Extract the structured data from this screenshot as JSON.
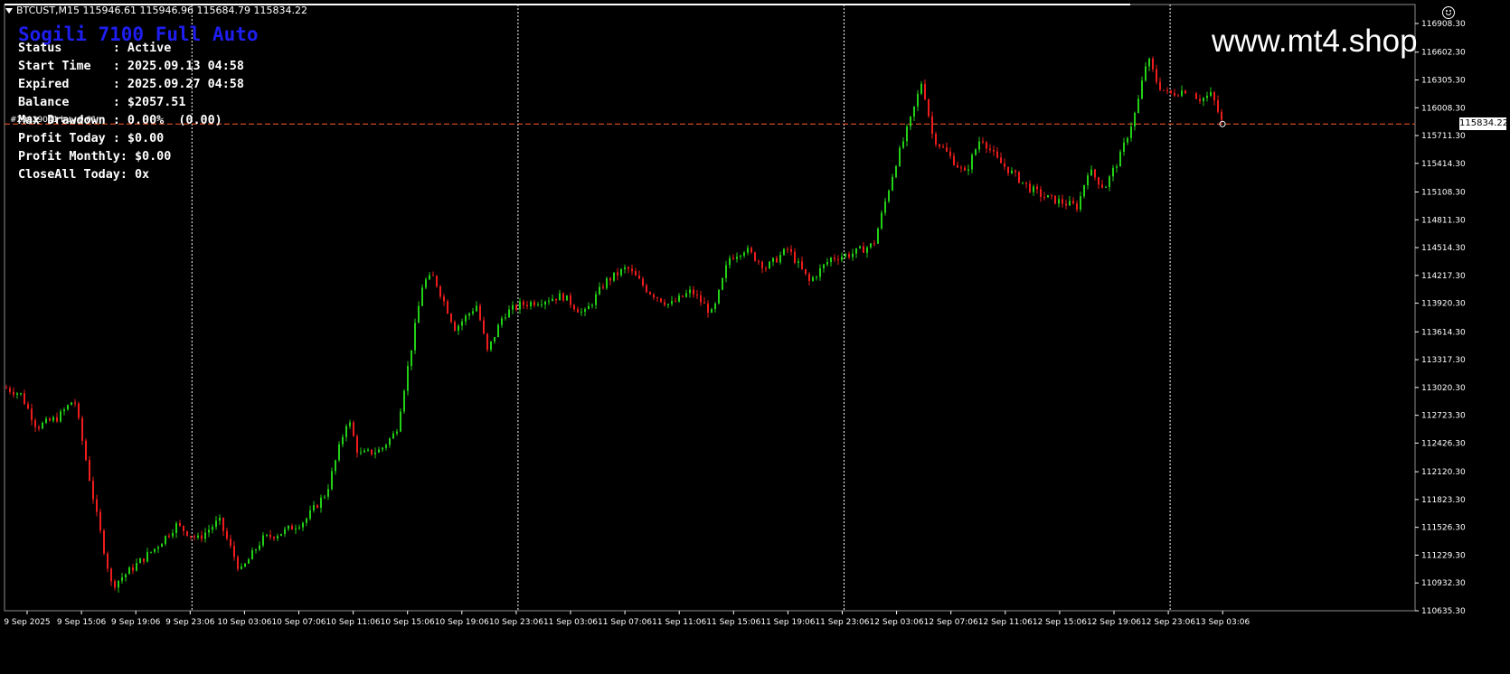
{
  "header": {
    "symbol": "BTCUST,M15",
    "ohlc": "115946.61 115946.96 115684.79 115834.22"
  },
  "ea": {
    "title": "Sogili 7100 Full Auto",
    "rows": [
      {
        "label": "Status       ",
        "value": ": Active"
      },
      {
        "label": "Start Time   ",
        "value": ": 2025.09.13 04:58"
      },
      {
        "label": "Expired      ",
        "value": ": 2025.09.27 04:58"
      },
      {
        "label": "Balance      ",
        "value": ": $2057.51"
      },
      {
        "label": "Max Drawdown ",
        "value": ": 0.00%  (0.00)"
      },
      {
        "label": "Profit Today ",
        "value": ": $0.00"
      },
      {
        "label": "Profit Monthly",
        "value": ": $0.00"
      },
      {
        "label": "CloseAll Today",
        "value": ": 0x"
      }
    ]
  },
  "watermark": "www.mt4.shop",
  "order_line_label": "#29929041 buy 0.01",
  "current_price": "115834.22",
  "colors": {
    "background": "#000000",
    "bull": "#22d016",
    "bear": "#ee1c1c",
    "ask_line": "#ff5a28",
    "grid": "#ffffff",
    "ea_title": "#1e1ef0"
  },
  "price_axis_ticks": [
    "116908.30",
    "116602.30",
    "116305.30",
    "116008.30",
    "115711.30",
    "115414.30",
    "115108.30",
    "114811.30",
    "114514.30",
    "114217.30",
    "113920.30",
    "113614.30",
    "113317.30",
    "113020.30",
    "112723.30",
    "112426.30",
    "112120.30",
    "111823.30",
    "111526.30",
    "111229.30",
    "110932.30",
    "110635.30"
  ],
  "time_axis_ticks": [
    "9 Sep 2025",
    "9 Sep 15:06",
    "9 Sep 19:06",
    "9 Sep 23:06",
    "10 Sep 03:06",
    "10 Sep 07:06",
    "10 Sep 11:06",
    "10 Sep 15:06",
    "10 Sep 19:06",
    "10 Sep 23:06",
    "11 Sep 03:06",
    "11 Sep 07:06",
    "11 Sep 11:06",
    "11 Sep 15:06",
    "11 Sep 19:06",
    "11 Sep 23:06",
    "12 Sep 03:06",
    "12 Sep 07:06",
    "12 Sep 11:06",
    "12 Sep 15:06",
    "12 Sep 19:06",
    "12 Sep 23:06",
    "13 Sep 03:06"
  ],
  "chart_data": {
    "type": "candlestick",
    "ylim": [
      110635.3,
      116908.3
    ],
    "current_price": 115834.22,
    "day_separators": [
      "9 Sep 23:06",
      "10 Sep 23:06",
      "11 Sep 23:06",
      "12 Sep 23:06"
    ],
    "close_path": [
      {
        "t": 0,
        "v": 113020
      },
      {
        "t": 0.03,
        "v": 112950
      },
      {
        "t": 0.06,
        "v": 112600
      },
      {
        "t": 0.1,
        "v": 112700
      },
      {
        "t": 0.13,
        "v": 112900
      },
      {
        "t": 0.17,
        "v": 111700
      },
      {
        "t": 0.2,
        "v": 110900
      },
      {
        "t": 0.24,
        "v": 111100
      },
      {
        "t": 0.28,
        "v": 111300
      },
      {
        "t": 0.32,
        "v": 111550
      },
      {
        "t": 0.36,
        "v": 111400
      },
      {
        "t": 0.4,
        "v": 111600
      },
      {
        "t": 0.44,
        "v": 111050
      },
      {
        "t": 0.48,
        "v": 111400
      },
      {
        "t": 0.52,
        "v": 111480
      },
      {
        "t": 0.56,
        "v": 111600
      },
      {
        "t": 0.6,
        "v": 111900
      },
      {
        "t": 0.64,
        "v": 112700
      },
      {
        "t": 0.66,
        "v": 112300
      },
      {
        "t": 0.7,
        "v": 112350
      },
      {
        "t": 0.73,
        "v": 112550
      },
      {
        "t": 0.76,
        "v": 113500
      },
      {
        "t": 0.78,
        "v": 114150
      },
      {
        "t": 0.8,
        "v": 114200
      },
      {
        "t": 0.84,
        "v": 113650
      },
      {
        "t": 0.88,
        "v": 113900
      },
      {
        "t": 0.9,
        "v": 113400
      },
      {
        "t": 0.93,
        "v": 113800
      },
      {
        "t": 0.96,
        "v": 113900
      },
      {
        "t": 1.0,
        "v": 113950
      },
      {
        "t": 1.04,
        "v": 114000
      },
      {
        "t": 1.08,
        "v": 113800
      },
      {
        "t": 1.12,
        "v": 114150
      },
      {
        "t": 1.16,
        "v": 114300
      },
      {
        "t": 1.2,
        "v": 114050
      },
      {
        "t": 1.24,
        "v": 113900
      },
      {
        "t": 1.28,
        "v": 114050
      },
      {
        "t": 1.32,
        "v": 113800
      },
      {
        "t": 1.35,
        "v": 114400
      },
      {
        "t": 1.38,
        "v": 114500
      },
      {
        "t": 1.42,
        "v": 114300
      },
      {
        "t": 1.46,
        "v": 114500
      },
      {
        "t": 1.5,
        "v": 114150
      },
      {
        "t": 1.54,
        "v": 114400
      },
      {
        "t": 1.58,
        "v": 114450
      },
      {
        "t": 1.62,
        "v": 114550
      },
      {
        "t": 1.66,
        "v": 115400
      },
      {
        "t": 1.69,
        "v": 115900
      },
      {
        "t": 1.71,
        "v": 116300
      },
      {
        "t": 1.73,
        "v": 115700
      },
      {
        "t": 1.76,
        "v": 115500
      },
      {
        "t": 1.79,
        "v": 115300
      },
      {
        "t": 1.82,
        "v": 115700
      },
      {
        "t": 1.85,
        "v": 115450
      },
      {
        "t": 1.88,
        "v": 115300
      },
      {
        "t": 1.91,
        "v": 115150
      },
      {
        "t": 1.94,
        "v": 115050
      },
      {
        "t": 1.97,
        "v": 115000
      },
      {
        "t": 2.0,
        "v": 114950
      },
      {
        "t": 2.02,
        "v": 115350
      },
      {
        "t": 2.05,
        "v": 115150
      },
      {
        "t": 2.08,
        "v": 115500
      },
      {
        "t": 2.11,
        "v": 116000
      },
      {
        "t": 2.13,
        "v": 116550
      },
      {
        "t": 2.15,
        "v": 116250
      },
      {
        "t": 2.17,
        "v": 116150
      },
      {
        "t": 2.2,
        "v": 116200
      },
      {
        "t": 2.23,
        "v": 116100
      },
      {
        "t": 2.25,
        "v": 116150
      },
      {
        "t": 2.27,
        "v": 115834
      }
    ],
    "x_end": 2.27
  }
}
